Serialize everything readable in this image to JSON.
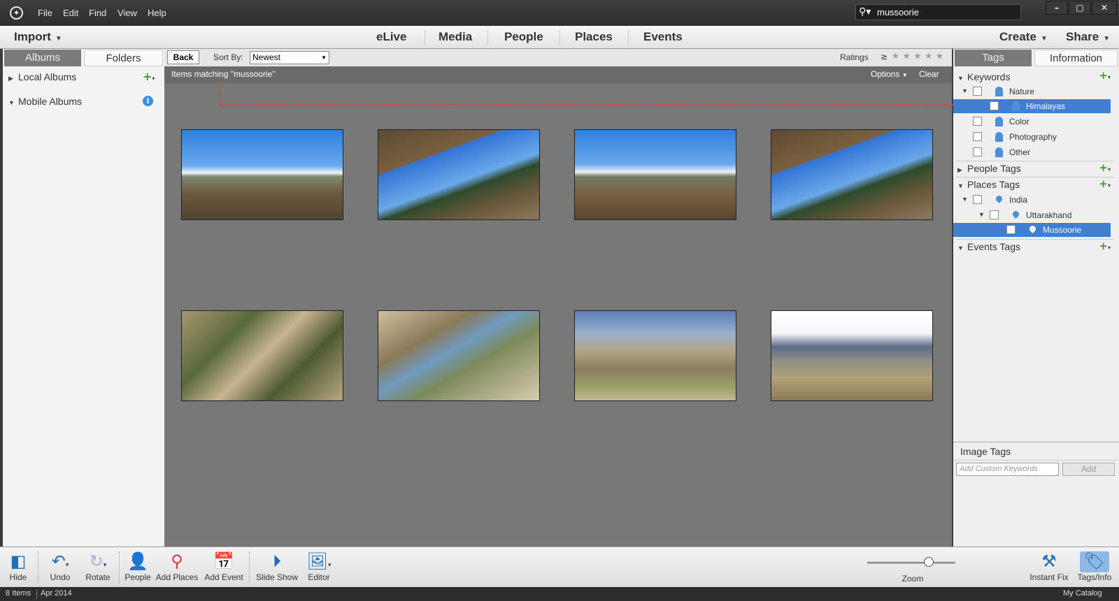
{
  "menu": [
    "File",
    "Edit",
    "Find",
    "View",
    "Help"
  ],
  "search": {
    "query": "mussoorie"
  },
  "window_buttons": [
    "–",
    "▢",
    "✕"
  ],
  "nav": {
    "import": "Import",
    "tabs": [
      "eLive",
      "Media",
      "People",
      "Places",
      "Events"
    ],
    "create": "Create",
    "share": "Share"
  },
  "left": {
    "tabs": [
      "Albums",
      "Folders"
    ],
    "items": [
      {
        "label": "Local Albums",
        "expanded": false
      },
      {
        "label": "Mobile Albums",
        "expanded": true
      }
    ]
  },
  "center": {
    "back": "Back",
    "sort_label": "Sort By:",
    "sort_value": "Newest",
    "ratings_label": "Ratings",
    "ratings_op": "≥",
    "stars": [
      "★",
      "★",
      "★",
      "★",
      "★"
    ],
    "match_text": "Items matching \"mussoorie\"",
    "options": "Options",
    "clear": "Clear",
    "photos": [
      "mountain-valley-1",
      "mountain-road-1",
      "mountain-valley-2",
      "mountain-road-2",
      "hillside-1",
      "hillside-2",
      "terraced-slopes",
      "peak-view"
    ]
  },
  "right": {
    "tabs": [
      "Tags",
      "Information"
    ],
    "keywords": {
      "title": "Keywords",
      "items": [
        {
          "label": "Nature",
          "level": 1,
          "expanded": true
        },
        {
          "label": "Himalayas",
          "level": 2,
          "selected": true
        },
        {
          "label": "Color",
          "level": 1
        },
        {
          "label": "Photography",
          "level": 1
        },
        {
          "label": "Other",
          "level": 1
        }
      ]
    },
    "people_tags": "People Tags",
    "places_tags": {
      "title": "Places Tags",
      "items": [
        {
          "label": "India",
          "level": 1
        },
        {
          "label": "Uttarakhand",
          "level": 2
        },
        {
          "label": "Mussoorie",
          "level": 3,
          "selected": true
        }
      ]
    },
    "events_tags": "Events Tags",
    "image_tags": {
      "title": "Image Tags",
      "placeholder": "Add Custom Keywords",
      "add": "Add"
    }
  },
  "toolbar": {
    "hide": "Hide",
    "undo": "Undo",
    "rotate": "Rotate",
    "people": "People",
    "add_places": "Add Places",
    "add_event": "Add Event",
    "slide_show": "Slide Show",
    "editor": "Editor",
    "zoom": "Zoom",
    "zoom_level": 0.7,
    "instant_fix": "Instant Fix",
    "tags_info": "Tags/Info"
  },
  "status": {
    "count": "8 Items",
    "date": "Apr 2014",
    "catalog": "My Catalog"
  },
  "colors": {
    "selection": "#3f7ed0",
    "accent_blue": "#1e6fb8",
    "add_green": "#3aa02a",
    "link_red": "#e23b3b"
  }
}
